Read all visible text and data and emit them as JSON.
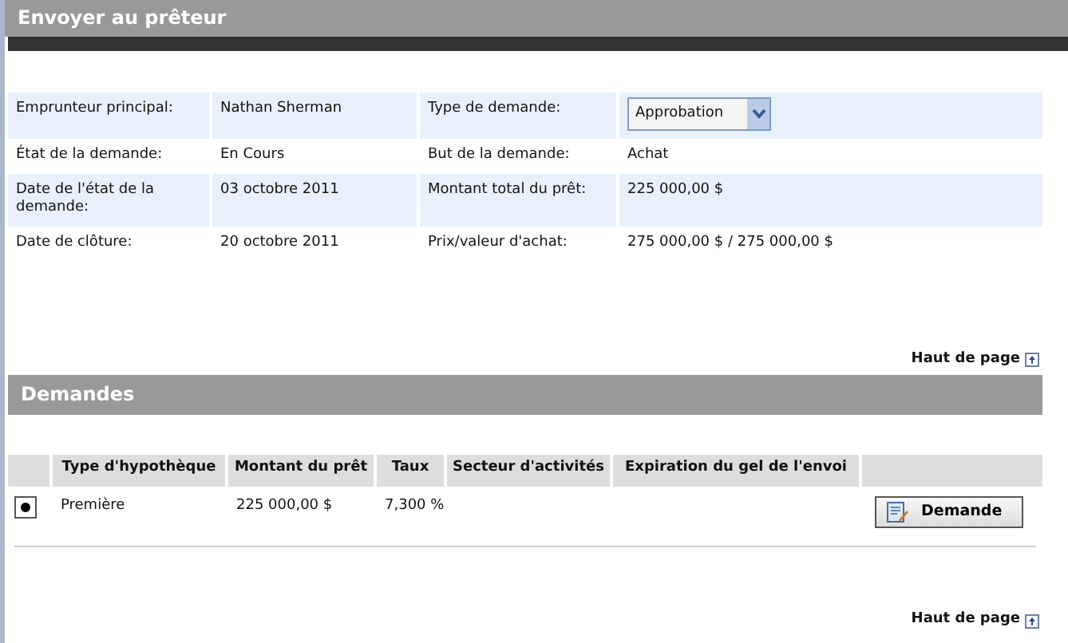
{
  "header": {
    "title": "Envoyer au prêteur"
  },
  "summary": [
    {
      "label": "Emprunteur principal:",
      "value": "Nathan Sherman",
      "label_2": "Type de demande:",
      "value_2": {
        "kind": "select",
        "text": "Approbation"
      }
    },
    {
      "label": "État de la demande:",
      "value": "En Cours",
      "label_2": "But de la demande:",
      "value_2": {
        "kind": "text",
        "text": "Achat"
      }
    },
    {
      "label": "Date de l'état de la demande:",
      "value": "03 octobre 2011",
      "label_2": "Montant total du prêt:",
      "value_2": {
        "kind": "text",
        "text": "225 000,00 $"
      }
    },
    {
      "label": "Date de clôture:",
      "value": "20 octobre 2011",
      "label_2": "Prix/valeur d'achat:",
      "value_2": {
        "kind": "text",
        "text": "275 000,00 $ / 275 000,00 $"
      }
    }
  ],
  "top_link_1": "Haut de page",
  "section": {
    "title": "Demandes"
  },
  "table": {
    "columns": [
      "Type d'hypothèque",
      "Montant du prêt",
      "Taux",
      "Secteur d'activités",
      "Expiration du gel de l'envoi"
    ],
    "rows": [
      {
        "selected": true,
        "cells": [
          "Première",
          "225 000,00 $",
          "7,300 %"
        ],
        "button": "Demande"
      }
    ]
  },
  "top_link_2": "Haut de page"
}
